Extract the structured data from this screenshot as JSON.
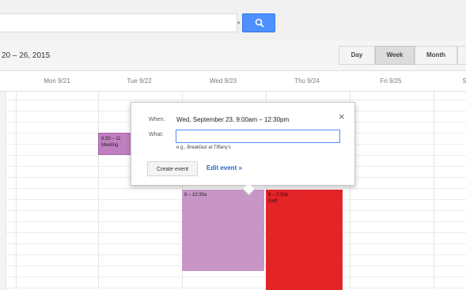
{
  "search": {
    "value": "",
    "button_icon": "search-icon",
    "accent": "#4d90fe"
  },
  "toolbar": {
    "date_range": "20 – 26, 2015",
    "views": {
      "day": "Day",
      "week": "Week",
      "month": "Month",
      "more": "4"
    },
    "active_view": "Week"
  },
  "days": [
    {
      "label": "Mon 9/21"
    },
    {
      "label": "Tue 9/22"
    },
    {
      "label": "Wed 9/23"
    },
    {
      "label": "Thu 9/24"
    },
    {
      "label": "Fri 9/25"
    },
    {
      "label": "S"
    }
  ],
  "events": [
    {
      "time": "8:30 – 11",
      "title": "Meeting",
      "color": "#c07fc0"
    },
    {
      "time": "8 – 10:30a",
      "title": "",
      "color": "#c796c7"
    },
    {
      "time": "8 – 2:30p",
      "title": "Golf",
      "color": "#e42528"
    }
  ],
  "popup": {
    "when_label": "When:",
    "when_value": "Wed, September 23, 9:00am – 12:30pm",
    "what_label": "What:",
    "what_value": "",
    "hint": "e.g., Breakfast at Tiffany's",
    "create_label": "Create event",
    "edit_label": "Edit event »",
    "close": "×"
  }
}
